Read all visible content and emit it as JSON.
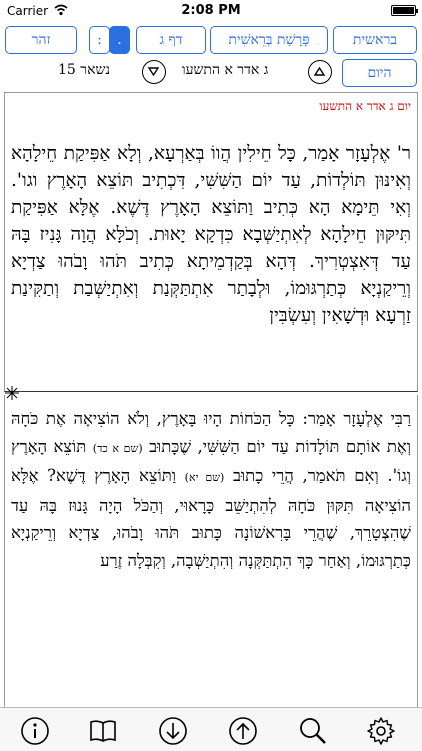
{
  "status": {
    "carrier": "Carrier",
    "time": "2:08 PM"
  },
  "nav": {
    "zohar": "זהר",
    "toggle_left": ":",
    "toggle_right": ".",
    "daf": "דף ג",
    "parsha": "פָּרָשַׁת בְּרֵאשִׁית",
    "bereshit": "בראשית"
  },
  "row2": {
    "remaining": "נשאר 15",
    "date": "ג אדר א התשעו",
    "today": "היום"
  },
  "reading": {
    "date_label": "יום ג אדר א התשעו",
    "aramaic_text": "ר' אֶלְעָזָר אָמַר, כָּל חֵילִין הֲווֹ בְּאַרְעָא, וְלָא אַפִּיקַת חֵילָהָא וְאִינּוּן תּוֹלְדוֹת, עַד יוֹם הַשִּׁשִּׁי, דִּכְתִיב תּוֹצֵא הָאָרֶץ וגו'. וְאִי תֵּימָא הָא כְּתִיב וַתּוֹצֵא הָאָרֶץ דֶּשֶׁא. אֶלָּא אַפִּיקַת תִּיקּוּן חֵילָהָא לְאִתְיַשְּׁבָא כִּדְקָא יָאוּת. וְכֹלָּא הֲוָה גָּנִיז בָּהּ עַד דְּאִצְטְרִיךְ. דְּהָא בְּקַדְמֵיתָא כְּתִיב תֹּהוּ וָבֹהוּ צַדְיָא וְרֵיקַנְיָא כְּתַרְגּוּמוֹ, וּלְבָתַר אִתְתַּקְּנַת וְאִתְיַשְּׁבַת וְתַקִּינַת זַרְעָא וּדְשָׁאִין וְעִשְׂבִּין",
    "hebrew_text_1": "רַבִּי אֶלְעָזָר אָמַר: כָּל הַכֹּחוֹת הָיוּ בָּאָרֶץ, וְלֹא הוֹצִיאָה אֶת כֹּחָהּ וְאֶת אוֹתָם תּוֹלָדוֹת עַד יוֹם הַשִּׁשִּׁי, שֶׁכָּתוּב",
    "ref_1": "(שם א כד)",
    "hebrew_text_2": "תּוֹצֵא הָאָרֶץ וְגוֹ'. וְאִם תֹּאמַר, הֲרֵי כָתוּב",
    "ref_2": "(שם יא)",
    "hebrew_text_3": "וַתּוֹצֵא הָאָרֶץ דֶּשֶׁא? אֶלָּא הוֹצִיאָה תִּקּוּן כֹּחָהּ לְהִתְיַשֵּׁב כָּרָאוּי, וְהַכֹּל הָיָה גָּנוּז בָּהּ עַד שֶׁהִצְטָרֵךְ, שֶׁהֲרֵי בָּרִאשׁוֹנָה כָּתוּב תֹּהוּ וָבֹהוּ, צַדְיָא וְרֵיקַנְיָא כְּתַרְגּוּמוֹ, וְאַחַר כָּךְ הִתְתַּקְּנָה וְהִתְיַשְּׁבָה, וְקִבְּלָה זֶרַע"
  },
  "colors": {
    "accent": "#2b6fe0",
    "date_red": "#d40000"
  },
  "icons": {
    "info": "info-icon",
    "book": "book-icon",
    "down": "arrow-down-icon",
    "up": "arrow-up-icon",
    "search": "search-icon",
    "settings": "gear-icon"
  }
}
